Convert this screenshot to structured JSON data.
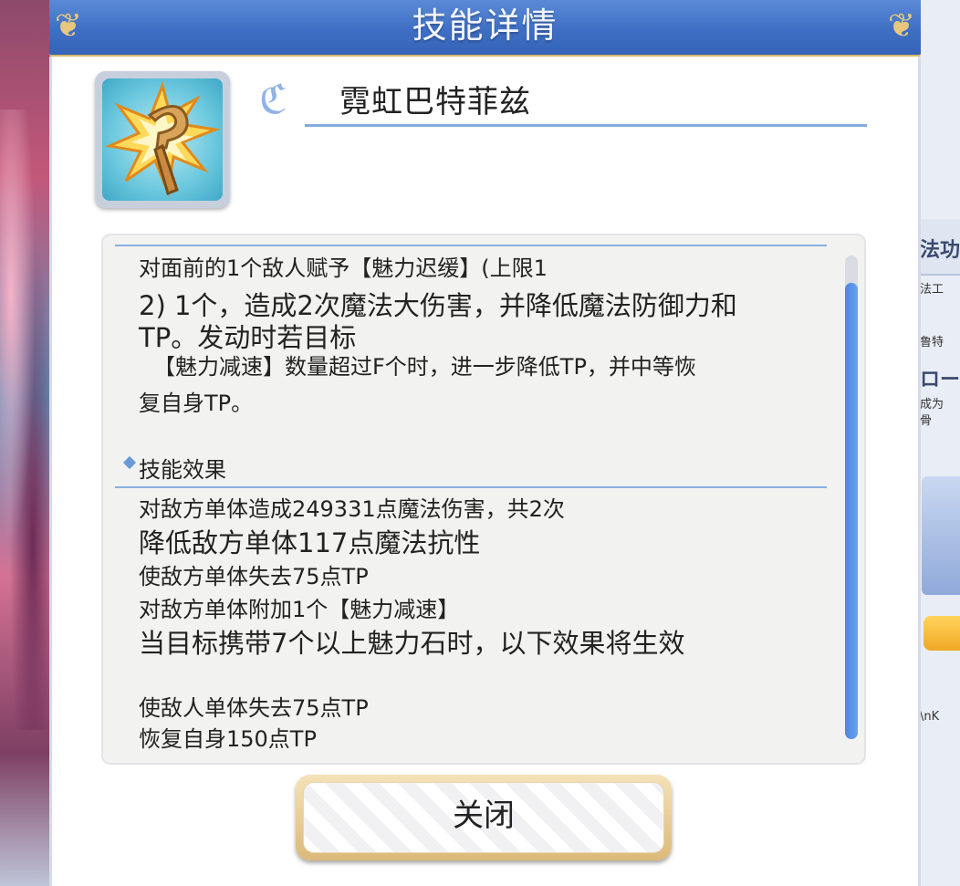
{
  "dialog": {
    "title": "技能详情",
    "close_label": "关闭"
  },
  "skill": {
    "name": "霓虹巴特菲兹",
    "icon": "magic-staff-burst-icon"
  },
  "description": {
    "lines": [
      "对面前的1个敌人赋予【魅力迟缓】(上限1",
      "2) 1个，造成2次魔法大伤害，并降低魔法防御力和",
      "TP。发动时若目标",
      "【魅力减速】数量超过F个时，进一步降低TP，并中等恢",
      "复自身TP。"
    ]
  },
  "effects": {
    "heading": "技能效果",
    "lines": [
      "对敌方单体造成249331点魔法伤害，共2次",
      "降低敌方单体117点魔法抗性",
      "使敌方单体失去75点TP",
      "对敌方单体附加1个【魅力减速】",
      "当目标携带7个以上魅力石时，以下效果将生效",
      "使敌人单体失去75点TP",
      "恢复自身150点TP"
    ]
  },
  "background_side": {
    "big_label": "法功",
    "text_1": "法工",
    "text_2": "鲁特",
    "big_label_2": "ロー",
    "text_3": "成为",
    "text_4": "骨",
    "text_5": "\\nK"
  },
  "colors": {
    "header_blue": "#3f6fc4",
    "accent_line": "#86a9de",
    "scrollbar": "#4c86e0",
    "button_gold": "#dcb979"
  }
}
